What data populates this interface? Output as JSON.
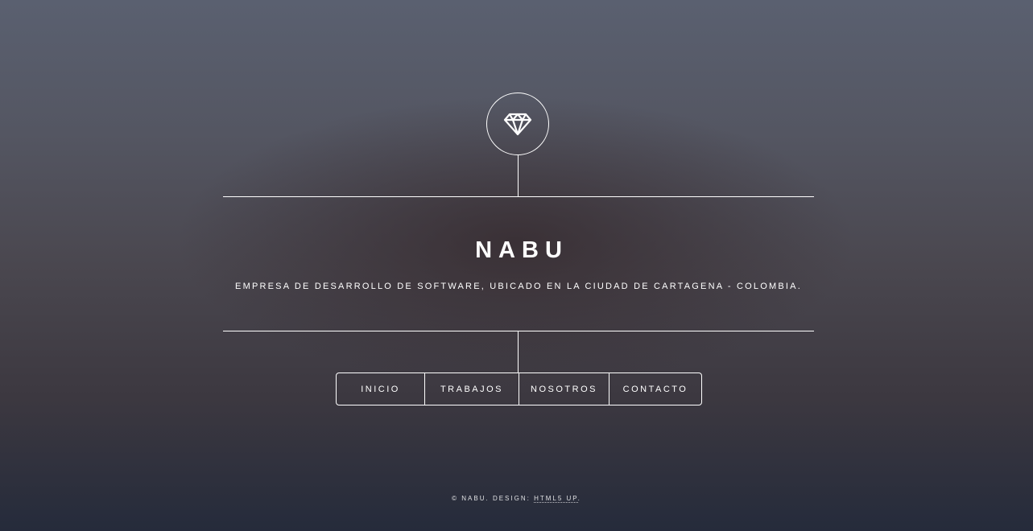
{
  "header": {
    "logo_icon": "diamond-icon",
    "title": "NABU",
    "subtitle": "EMPRESA DE DESARROLLO DE SOFTWARE, UBICADO EN LA CIUDAD DE CARTAGENA - COLOMBIA."
  },
  "nav": {
    "items": [
      {
        "label": "INICIO"
      },
      {
        "label": "TRABAJOS"
      },
      {
        "label": "NOSOTROS"
      },
      {
        "label": "CONTACTO"
      }
    ]
  },
  "footer": {
    "copyright": "© NABU. DESIGN:",
    "link_label": "HTML5 UP",
    "period": "."
  },
  "colors": {
    "text": "#ffffff",
    "bg_top": "#5a6070",
    "bg_bottom": "#252b3b"
  }
}
